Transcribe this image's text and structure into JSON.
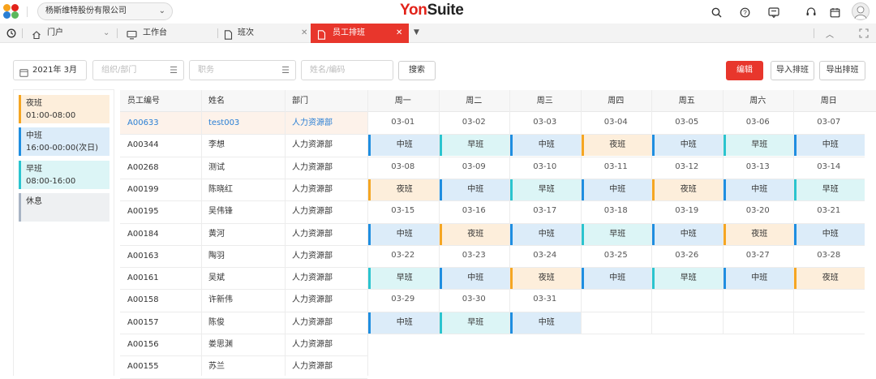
{
  "header": {
    "company": "杨斯维特股份有限公司",
    "brand_yon": "Yon",
    "brand_suite": "Suite",
    "icons": [
      "search-icon",
      "help-icon",
      "message-icon",
      "headset-icon",
      "calendar-icon",
      "user-avatar"
    ]
  },
  "tabs": [
    {
      "label": "门户",
      "icon": "home-icon"
    },
    {
      "label": "工作台",
      "icon": "monitor-icon"
    },
    {
      "label": "班次",
      "icon": "document-icon"
    },
    {
      "label": "员工排班",
      "icon": "document-icon",
      "active": true
    }
  ],
  "filters": {
    "month": "2021年 3月",
    "org_placeholder": "组织/部门",
    "position_placeholder": "职务",
    "name_placeholder": "姓名/编码",
    "search": "搜索",
    "edit": "编辑",
    "import": "导入排班",
    "export": "导出排班"
  },
  "shifts": [
    {
      "name": "夜班",
      "time": "01:00-08:00",
      "color": "#f5a623",
      "bg": "#fdeedb"
    },
    {
      "name": "中班",
      "time": "16:00-00:00(次日)",
      "color": "#1f8ee0",
      "bg": "#dcecf9"
    },
    {
      "name": "早班",
      "time": "08:00-16:00",
      "color": "#2bc4cf",
      "bg": "#dcf5f6"
    },
    {
      "name": "休息",
      "time": "",
      "color": "#a8b4c4",
      "bg": "#eef0f2"
    }
  ],
  "table": {
    "headers": [
      "员工编号",
      "姓名",
      "部门"
    ],
    "days": [
      "周一",
      "周二",
      "周三",
      "周四",
      "周五",
      "周六",
      "周日"
    ],
    "employees": [
      {
        "id": "A00633",
        "name": "test003",
        "dept": "人力资源部"
      },
      {
        "id": "A00344",
        "name": "李想",
        "dept": "人力资源部"
      },
      {
        "id": "A00268",
        "name": "测试",
        "dept": "人力资源部"
      },
      {
        "id": "A00199",
        "name": "陈晓红",
        "dept": "人力资源部"
      },
      {
        "id": "A00195",
        "name": "吴伟锋",
        "dept": "人力资源部"
      },
      {
        "id": "A00184",
        "name": "黄河",
        "dept": "人力资源部"
      },
      {
        "id": "A00163",
        "name": "陶羽",
        "dept": "人力资源部"
      },
      {
        "id": "A00161",
        "name": "吴斌",
        "dept": "人力资源部"
      },
      {
        "id": "A00158",
        "name": "许新伟",
        "dept": "人力资源部"
      },
      {
        "id": "A00157",
        "name": "陈俊",
        "dept": "人力资源部"
      },
      {
        "id": "A00156",
        "name": "娄思渊",
        "dept": "人力资源部"
      },
      {
        "id": "A00155",
        "name": "苏兰",
        "dept": "人力资源部"
      }
    ]
  },
  "calendar": [
    {
      "dates": [
        "03-01",
        "03-02",
        "03-03",
        "03-04",
        "03-05",
        "03-06",
        "03-07"
      ],
      "shifts": [
        "中班",
        "早班",
        "中班",
        "夜班",
        "中班",
        "早班",
        "中班"
      ]
    },
    {
      "dates": [
        "03-08",
        "03-09",
        "03-10",
        "03-11",
        "03-12",
        "03-13",
        "03-14"
      ],
      "shifts": [
        "夜班",
        "中班",
        "早班",
        "中班",
        "夜班",
        "中班",
        "早班"
      ]
    },
    {
      "dates": [
        "03-15",
        "03-16",
        "03-17",
        "03-18",
        "03-19",
        "03-20",
        "03-21"
      ],
      "shifts": [
        "中班",
        "夜班",
        "中班",
        "早班",
        "中班",
        "夜班",
        "中班"
      ]
    },
    {
      "dates": [
        "03-22",
        "03-23",
        "03-24",
        "03-25",
        "03-26",
        "03-27",
        "03-28"
      ],
      "shifts": [
        "早班",
        "中班",
        "夜班",
        "中班",
        "早班",
        "中班",
        "夜班"
      ]
    },
    {
      "dates": [
        "03-29",
        "03-30",
        "03-31",
        "",
        "",
        "",
        ""
      ],
      "shifts": [
        "中班",
        "早班",
        "中班",
        "",
        "",
        "",
        ""
      ]
    }
  ]
}
